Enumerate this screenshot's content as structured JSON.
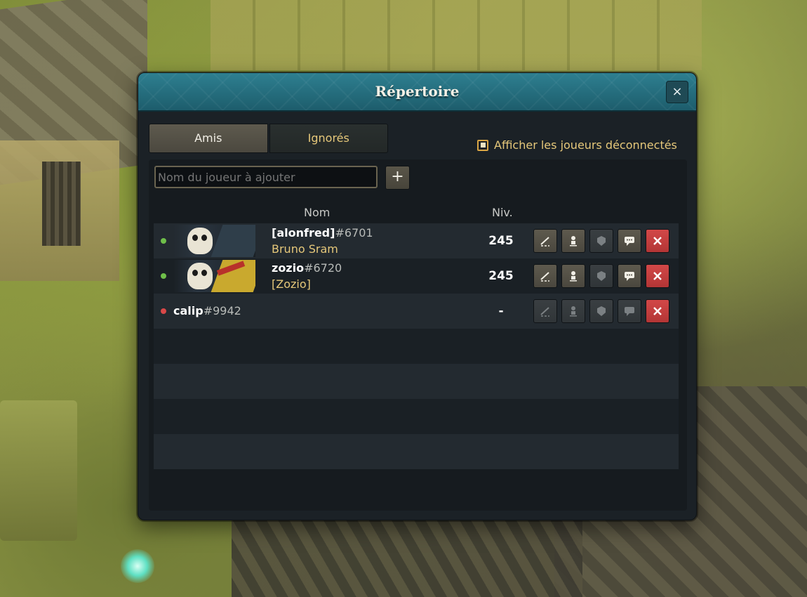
{
  "window": {
    "title": "Répertoire",
    "close_label": "×"
  },
  "tabs": [
    {
      "label": "Amis",
      "active": true
    },
    {
      "label": "Ignorés",
      "active": false
    }
  ],
  "show_offline": {
    "label": "Afficher les joueurs déconnectés",
    "checked": true
  },
  "add_player": {
    "placeholder": "Nom du joueur à ajouter",
    "button_label": "+"
  },
  "columns": {
    "name": "Nom",
    "level": "Niv."
  },
  "friends": [
    {
      "status": "online",
      "account": "[alonfred]",
      "tag": "#6701",
      "character": "Bruno Sram",
      "level": "245",
      "portrait_icon": "skull-character-portrait",
      "actions": [
        "invite-icon",
        "join-icon",
        "guild-icon",
        "chat-icon",
        "remove-icon"
      ]
    },
    {
      "status": "online",
      "account": "zozio",
      "tag": "#6720",
      "character": "[Zozio]",
      "level": "245",
      "portrait_icon": "skull-character-portrait",
      "actions": [
        "invite-icon",
        "join-icon",
        "guild-icon",
        "chat-icon",
        "remove-icon"
      ]
    },
    {
      "status": "offline",
      "account": "calip",
      "tag": "#9942",
      "character": "",
      "level": "-",
      "actions": [
        "invite-icon",
        "join-icon",
        "guild-icon",
        "chat-icon",
        "remove-icon"
      ]
    }
  ],
  "colors": {
    "accent_gold": "#e6c87a",
    "titlebar_teal": "#2e7f90",
    "online": "#6fbf4a",
    "offline": "#d94848",
    "remove_red": "#d24848"
  }
}
